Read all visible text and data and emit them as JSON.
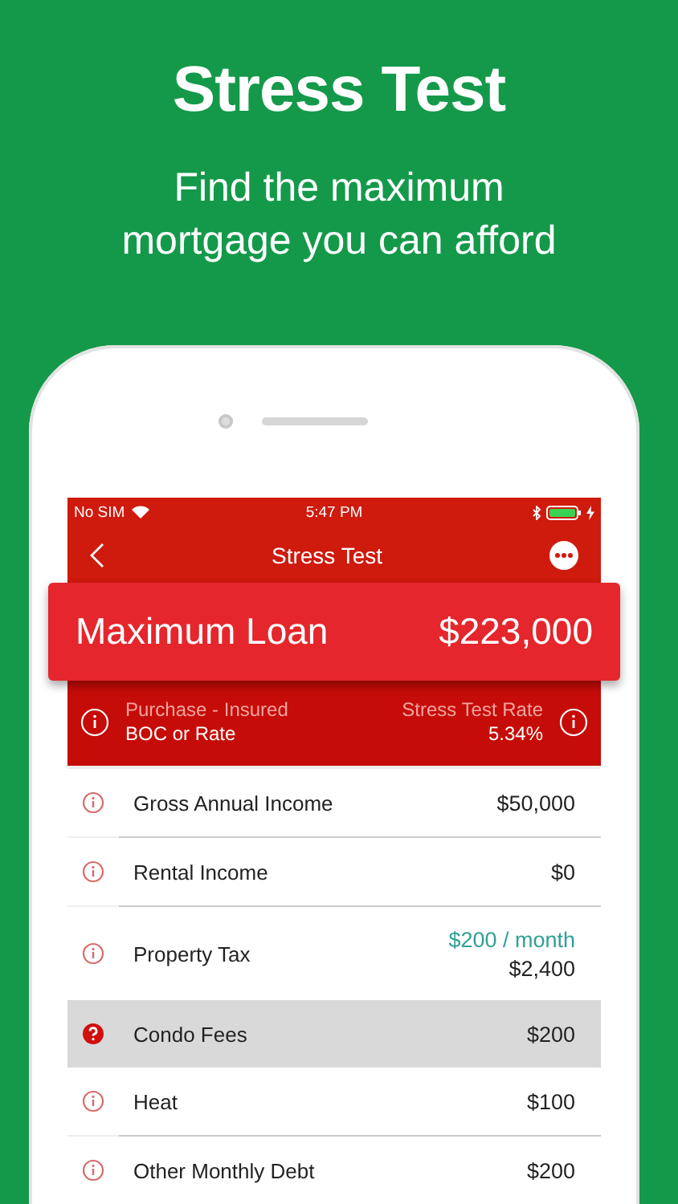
{
  "headline": "Stress Test",
  "subtitle": "Find the maximum mortgage you can afford",
  "status_bar": {
    "carrier": "No SIM",
    "time": "5:47 PM"
  },
  "nav": {
    "title": "Stress Test"
  },
  "result": {
    "label": "Maximum Loan",
    "value": "$223,000"
  },
  "scenario": {
    "type": "Purchase - Insured",
    "basis": "BOC or Rate",
    "rate_label": "Stress Test Rate",
    "rate": "5.34%"
  },
  "rows": [
    {
      "label": "Gross Annual Income",
      "value": "$50,000",
      "selected": false
    },
    {
      "label": "Rental Income",
      "value": "$0",
      "selected": false
    },
    {
      "label": "Property Tax",
      "monthly": "$200 / month",
      "value": "$2,400",
      "selected": false
    },
    {
      "label": "Condo Fees",
      "value": "$200",
      "selected": true
    },
    {
      "label": "Heat",
      "value": "$100",
      "selected": false
    },
    {
      "label": "Other Monthly Debt",
      "value": "$200",
      "selected": false
    }
  ]
}
